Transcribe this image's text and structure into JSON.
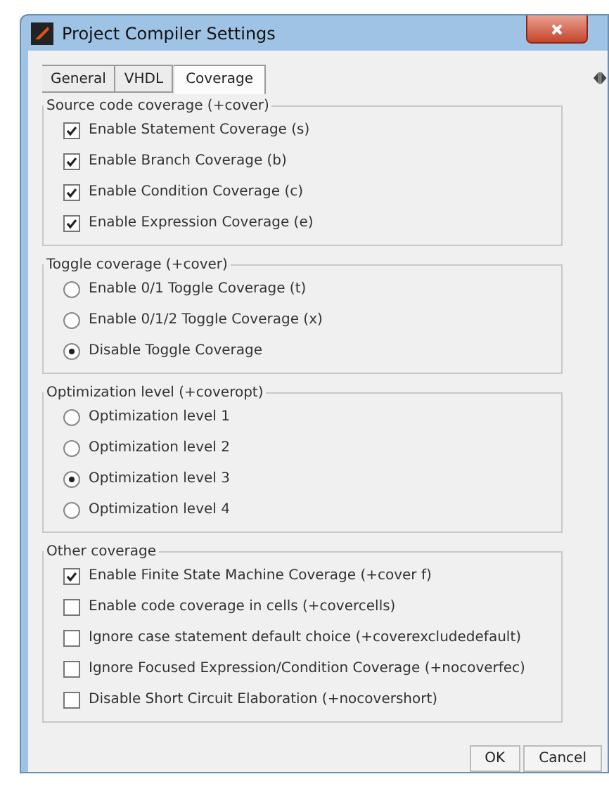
{
  "window": {
    "title": "Project Compiler Settings"
  },
  "tabs": [
    {
      "label": "General",
      "selected": false
    },
    {
      "label": "VHDL",
      "selected": false
    },
    {
      "label": "Coverage",
      "selected": true
    }
  ],
  "groups": [
    {
      "title": "Source code coverage (+cover)",
      "kind": "checkbox",
      "options": [
        {
          "label": "Enable Statement Coverage (s)",
          "checked": true
        },
        {
          "label": "Enable Branch Coverage (b)",
          "checked": true
        },
        {
          "label": "Enable Condition Coverage (c)",
          "checked": true
        },
        {
          "label": "Enable Expression Coverage (e)",
          "checked": true
        }
      ]
    },
    {
      "title": "Toggle coverage (+cover)",
      "kind": "radio",
      "options": [
        {
          "label": "Enable 0/1 Toggle Coverage (t)",
          "selected": false
        },
        {
          "label": "Enable 0/1/2 Toggle Coverage (x)",
          "selected": false
        },
        {
          "label": "Disable Toggle Coverage",
          "selected": true
        }
      ]
    },
    {
      "title": "Optimization level (+coveropt)",
      "kind": "radio",
      "options": [
        {
          "label": "Optimization level 1",
          "selected": false
        },
        {
          "label": "Optimization level 2",
          "selected": false
        },
        {
          "label": "Optimization level 3",
          "selected": true
        },
        {
          "label": "Optimization level 4",
          "selected": false
        }
      ]
    },
    {
      "title": "Other coverage",
      "kind": "checkbox",
      "options": [
        {
          "label": "Enable Finite State Machine Coverage (+cover f)",
          "checked": true
        },
        {
          "label": "Enable code coverage in cells (+covercells)",
          "checked": false
        },
        {
          "label": "Ignore case statement default choice (+coverexcludedefault)",
          "checked": false
        },
        {
          "label": "Ignore Focused Expression/Condition Coverage (+nocoverfec)",
          "checked": false
        },
        {
          "label": "Disable Short Circuit Elaboration (+nocovershort)",
          "checked": false
        }
      ]
    }
  ],
  "buttons": [
    "OK",
    "Cancel"
  ]
}
